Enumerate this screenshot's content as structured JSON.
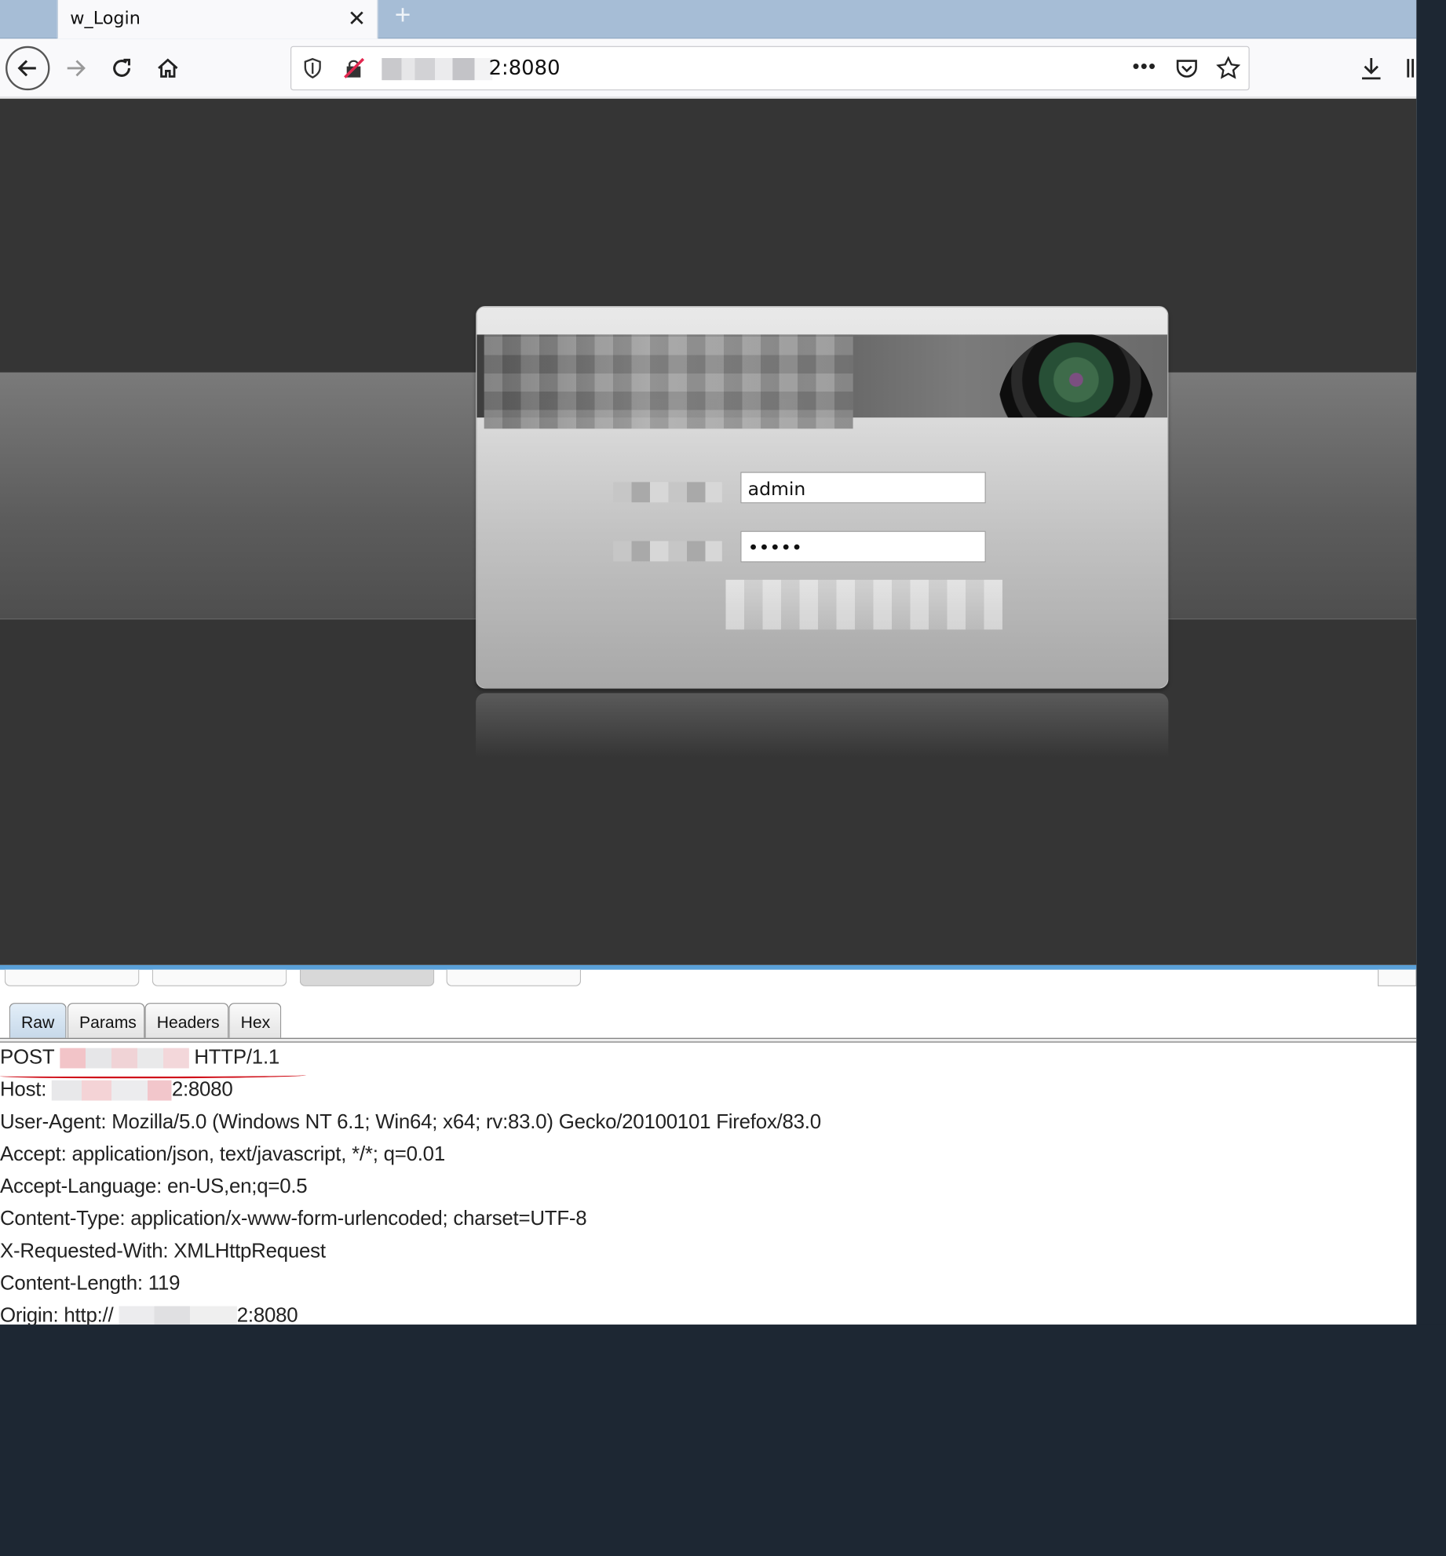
{
  "browser": {
    "tab_title": "w_Login",
    "tab_close": "✕",
    "new_tab": "+",
    "url_visible": "2:8080",
    "page_actions": "•••"
  },
  "login": {
    "username_value": "admin",
    "password_value": "•••••"
  },
  "burp": {
    "tabs": [
      "Raw",
      "Params",
      "Headers",
      "Hex"
    ],
    "active_tab": "Raw",
    "request_line_method": "POST",
    "request_line_version": "HTTP/1.1",
    "host_label": "Host:",
    "host_suffix": "2:8080",
    "user_agent": "User-Agent: Mozilla/5.0 (Windows NT 6.1; Win64; x64; rv:83.0) Gecko/20100101 Firefox/83.0",
    "accept": "Accept: application/json, text/javascript, */*; q=0.01",
    "accept_language": "Accept-Language: en-US,en;q=0.5",
    "content_type": "Content-Type: application/x-www-form-urlencoded; charset=UTF-8",
    "x_requested_with": "X-Requested-With: XMLHttpRequest",
    "content_length": "Content-Length: 119",
    "origin_label": "Origin: http://",
    "origin_suffix": "2:8080"
  },
  "colors": {
    "burp_accent": "#5aa0d8",
    "highlight_underline": "#d0101a"
  }
}
